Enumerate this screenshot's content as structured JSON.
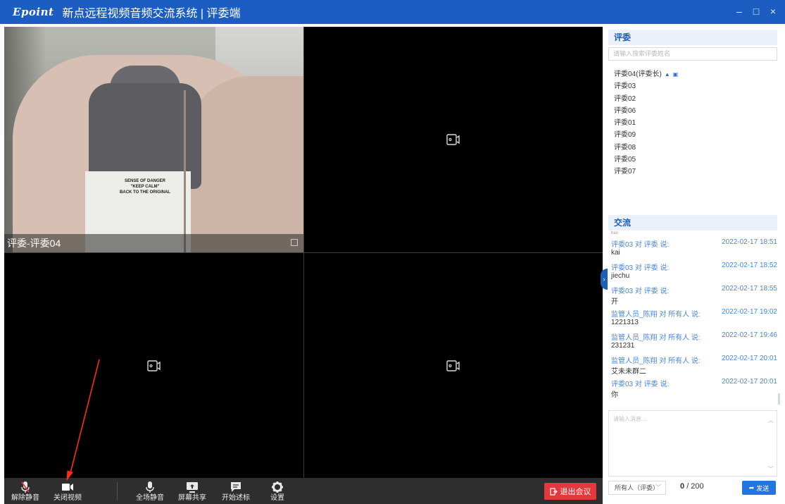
{
  "window": {
    "brand": "Epoint",
    "title": "新点远程视频音频交流系统 | 评委端",
    "minimize": "–",
    "maximize": "□",
    "close": "×"
  },
  "video": {
    "tile1_name": "评委-评委04",
    "tee_print": "SENSE OF DANGER\n\"KEEP CALM\"\nBACK TO THE ORIGINAL"
  },
  "toolbar": {
    "unmute": "解除静音",
    "close_video": "关闭视频",
    "mute_all": "全场静音",
    "screen_share": "屏幕共享",
    "start_bid": "开始述标",
    "settings": "设置",
    "exit": "退出会议"
  },
  "judges": {
    "section_title": "评委",
    "search_placeholder": "请输入搜索评委姓名",
    "items": [
      {
        "label": "评委04(评委长)"
      },
      {
        "label": "评委03"
      },
      {
        "label": "评委02"
      },
      {
        "label": "评委06"
      },
      {
        "label": "评委01"
      },
      {
        "label": "评委09"
      },
      {
        "label": "评委08"
      },
      {
        "label": "评委05"
      },
      {
        "label": "评委07"
      }
    ]
  },
  "chat": {
    "section_title": "交流",
    "cut_top": "hao",
    "messages": [
      {
        "from": "评委03  对 评委 说:",
        "time": "2022-02-17 18:51",
        "text": "kai"
      },
      {
        "from": "评委03  对 评委 说:",
        "time": "2022-02-17 18:52",
        "text": "jiechu"
      },
      {
        "from": "评委03  对 评委 说:",
        "time": "2022-02-17 18:55",
        "text": "开"
      },
      {
        "from": "监管人员_陈翔 对 所有人 说:",
        "time": "2022-02-17 19:02",
        "text": "1221313"
      },
      {
        "from": "监管人员_陈翔 对 所有人 说:",
        "time": "2022-02-17 19:46",
        "text": "231231"
      },
      {
        "from": "监管人员_陈翔 对 所有人 说:",
        "time": "2022-02-17 20:01",
        "text": "艾未未群二"
      },
      {
        "from": "评委03  对 评委 说:",
        "time": "2022-02-17 20:01",
        "text": "你"
      }
    ],
    "input_placeholder": "请输入消息...",
    "target": "所有人（评委）",
    "count": "0",
    "max": "/ 200",
    "send": "发送"
  },
  "colors": {
    "titlebar": "#1c5dc2",
    "accent": "#1d5fb8",
    "exit": "#e4393c",
    "send": "#2275e0"
  }
}
